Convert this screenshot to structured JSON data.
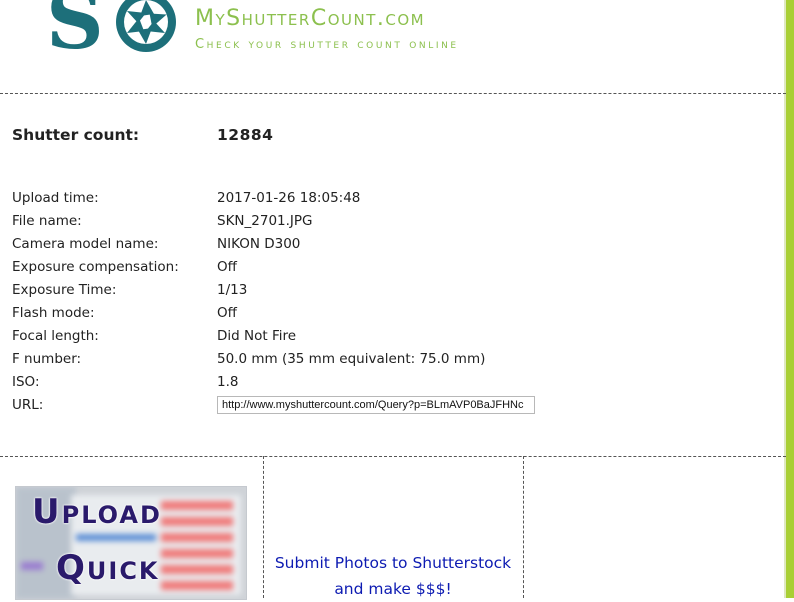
{
  "header": {
    "site_name": "MyShutterCount.com",
    "tagline": "Check your shutter count online",
    "logo_initials": "SC"
  },
  "shutter_count": {
    "label": "Shutter count:",
    "value": "12884"
  },
  "info_rows": [
    {
      "label": "Upload time:",
      "value": "2017-01-26 18:05:48"
    },
    {
      "label": "File name:",
      "value": "SKN_2701.JPG"
    },
    {
      "label": "Camera model name:",
      "value": "NIKON D300"
    },
    {
      "label": "Exposure compensation:",
      "value": "Off"
    },
    {
      "label": "Exposure Time:",
      "value": "1/13"
    },
    {
      "label": "Flash mode:",
      "value": "Off"
    },
    {
      "label": "Focal length:",
      "value": "Did Not Fire"
    },
    {
      "label": "F number:",
      "value": "50.0 mm (35 mm equivalent: 75.0 mm)"
    },
    {
      "label": "ISO:",
      "value": "1.8"
    }
  ],
  "url_row": {
    "label": "URL:",
    "value": "http://www.myshuttercount.com/Query?p=BLmAVP0BaJFHNc"
  },
  "ad": {
    "line1": "Upload",
    "line2": "Quick"
  },
  "promo": {
    "line1": "Submit Photos to Shutterstock",
    "line2": "and make $$$!"
  },
  "colors": {
    "brand_green": "#8cc04e",
    "logo_teal": "#1d6f7a",
    "accent_bar": "#a9cf34",
    "link_blue": "#0d1bb2"
  }
}
